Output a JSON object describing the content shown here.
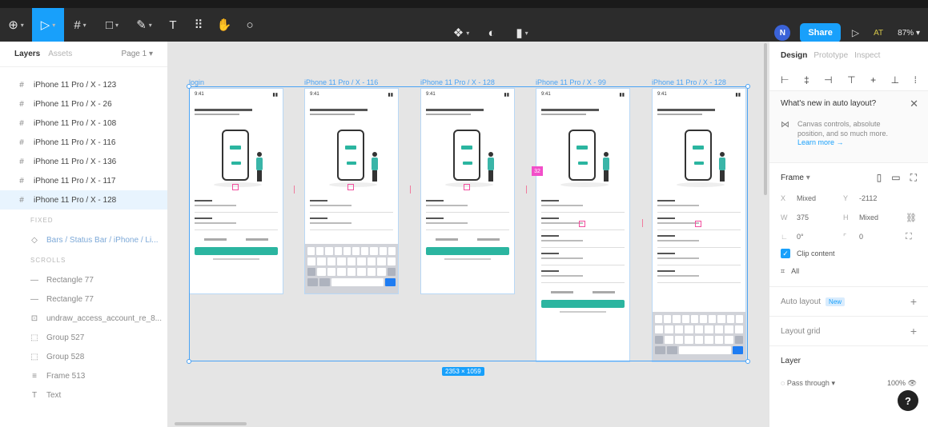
{
  "toolbar": {
    "tools": [
      {
        "name": "main-menu",
        "glyph": "⊕"
      },
      {
        "name": "move",
        "glyph": "▷"
      },
      {
        "name": "frame",
        "glyph": "#"
      },
      {
        "name": "shape",
        "glyph": "□"
      },
      {
        "name": "pen",
        "glyph": "✎"
      },
      {
        "name": "text",
        "glyph": "T"
      },
      {
        "name": "resources",
        "glyph": "⠿"
      },
      {
        "name": "hand",
        "glyph": "✋"
      },
      {
        "name": "comment",
        "glyph": "○"
      }
    ],
    "share_label": "Share",
    "avatar_initial": "N",
    "ai_label": "AT",
    "zoom_label": "87%"
  },
  "left_panel": {
    "tab_layers": "Layers",
    "tab_assets": "Assets",
    "page_label": "Page 1",
    "layers": [
      {
        "label": "iPhone 11 Pro / X - 123",
        "type": "frame"
      },
      {
        "label": "iPhone 11 Pro / X - 26",
        "type": "frame"
      },
      {
        "label": "iPhone 11 Pro / X - 108",
        "type": "frame"
      },
      {
        "label": "iPhone 11 Pro / X - 116",
        "type": "frame"
      },
      {
        "label": "iPhone 11 Pro / X - 136",
        "type": "frame"
      },
      {
        "label": "iPhone 11 Pro / X - 117",
        "type": "frame"
      },
      {
        "label": "iPhone 11 Pro / X - 128",
        "type": "frame",
        "selected": true
      }
    ],
    "section_fixed": "FIXED",
    "fixed_child": "Bars / Status Bar / iPhone / Li...",
    "section_scrolls": "SCROLLS",
    "children": [
      {
        "label": "Rectangle 77",
        "icon": "—"
      },
      {
        "label": "Rectangle 77",
        "icon": "—"
      },
      {
        "label": "undraw_access_account_re_8...",
        "icon": "⊡"
      },
      {
        "label": "Group 527",
        "icon": "⬚"
      },
      {
        "label": "Group 528",
        "icon": "⬚"
      },
      {
        "label": "Frame 513",
        "icon": "≡"
      },
      {
        "label": "Text",
        "icon": "T"
      }
    ]
  },
  "canvas": {
    "frames": [
      {
        "label": "login",
        "keyboard": false
      },
      {
        "label": "iPhone 11 Pro / X - 116",
        "keyboard": true
      },
      {
        "label": "iPhone 11 Pro / X - 128",
        "keyboard": false
      },
      {
        "label": "iPhone 11 Pro / X - 99",
        "keyboard": false
      },
      {
        "label": "iPhone 11 Pro / X - 128",
        "keyboard": true
      }
    ],
    "status_time": "9:41",
    "selection_size": "2353 × 1059",
    "spacing_badge": "32"
  },
  "right_panel": {
    "tab_design": "Design",
    "tab_prototype": "Prototype",
    "tab_inspect": "Inspect",
    "whats_new_title": "What's new in auto layout?",
    "whats_new_body": "Canvas controls, absolute position, and so much more.",
    "whats_new_link": "Learn more →",
    "frame_title": "Frame",
    "x_label": "X",
    "x_value": "Mixed",
    "y_label": "Y",
    "y_value": "-2112",
    "w_label": "W",
    "w_value": "375",
    "h_label": "H",
    "h_value": "Mixed",
    "rotation_value": "0°",
    "radius_value": "0",
    "clip_label": "Clip content",
    "constraint_value": "All",
    "auto_layout_label": "Auto layout",
    "new_badge": "New",
    "layout_grid_label": "Layout grid",
    "layer_label": "Layer",
    "blend_label": "Pass through",
    "opacity_value": "100%"
  }
}
